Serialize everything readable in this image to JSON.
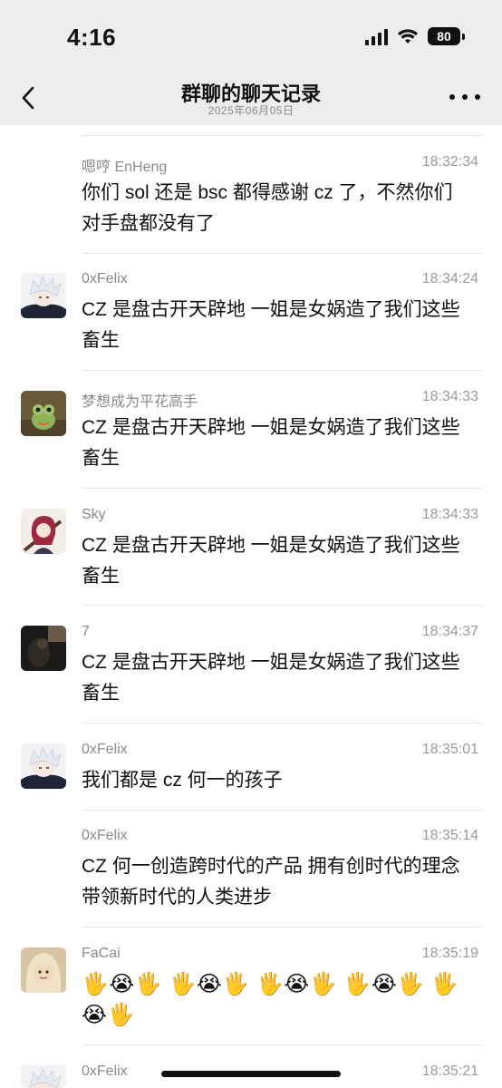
{
  "status_bar": {
    "time": "4:16",
    "battery": "80"
  },
  "header": {
    "title": "群聊的聊天记录",
    "subtitle": "2025年06月05日"
  },
  "messages": [
    {
      "sender": "嗯哼 EnHeng",
      "time": "18:32:34",
      "text": "你们 sol 还是 bsc 都得感谢 cz 了，不然你们对手盘都没有了"
    },
    {
      "sender": "0xFelix",
      "time": "18:34:24",
      "text": "CZ 是盘古开天辟地 一姐是女娲造了我们这些畜生"
    },
    {
      "sender": "梦想成为平花高手",
      "time": "18:34:33",
      "text": "CZ 是盘古开天辟地 一姐是女娲造了我们这些畜生"
    },
    {
      "sender": "Sky",
      "time": "18:34:33",
      "text": "CZ 是盘古开天辟地 一姐是女娲造了我们这些畜生"
    },
    {
      "sender": "7",
      "time": "18:34:37",
      "text": "CZ 是盘古开天辟地 一姐是女娲造了我们这些畜生"
    },
    {
      "sender": "0xFelix",
      "time": "18:35:01",
      "text": "我们都是 cz 何一的孩子"
    },
    {
      "sender": "0xFelix",
      "time": "18:35:14",
      "text": "CZ 何一创造跨时代的产品 拥有创时代的理念 带领新时代的人类进步"
    },
    {
      "sender": "FaCai",
      "time": "18:35:19",
      "text": "🖐😭🖐 🖐😭🖐 🖐😭🖐 🖐😭🖐 🖐😭🖐"
    },
    {
      "sender": "0xFelix",
      "time": "18:35:21",
      "text": ""
    }
  ]
}
